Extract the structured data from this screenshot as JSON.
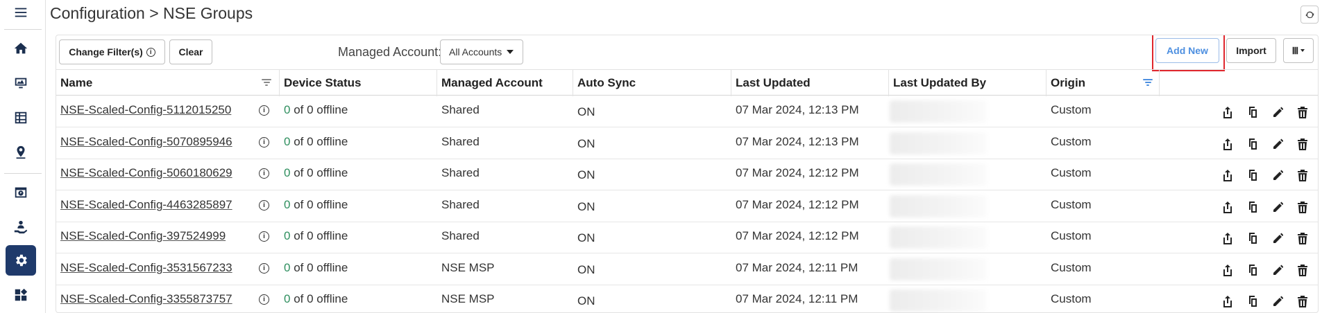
{
  "header": {
    "title": "Configuration > NSE Groups"
  },
  "sidebar": {
    "items": [
      {
        "icon": "menu-icon"
      },
      {
        "icon": "home-icon"
      },
      {
        "icon": "monitor-icon"
      },
      {
        "icon": "table-icon"
      },
      {
        "icon": "location-pin-icon"
      },
      {
        "icon": "dashboard-window-icon"
      },
      {
        "icon": "users-hand-icon"
      },
      {
        "icon": "gear-icon",
        "active": true
      },
      {
        "icon": "widgets-icon"
      }
    ]
  },
  "toolbar": {
    "change_filters_label": "Change Filter(s)",
    "info_glyph": "i",
    "clear_label": "Clear",
    "managed_account_label": "Managed Account:",
    "managed_account_value": "All Accounts",
    "add_new_label": "Add New",
    "import_label": "Import",
    "column_picker_glyph": "Ⅲ"
  },
  "table": {
    "columns": [
      "Name",
      "Device Status",
      "Managed Account",
      "Auto Sync",
      "Last Updated",
      "Last Updated By",
      "Origin"
    ],
    "rows": [
      {
        "name": "NSE-Scaled-Config-5112015250",
        "status_count": "0",
        "status_rest": "of 0 offline",
        "account": "Shared",
        "sync": "ON",
        "updated": "07 Mar 2024, 12:13 PM",
        "origin": "Custom"
      },
      {
        "name": "NSE-Scaled-Config-5070895946",
        "status_count": "0",
        "status_rest": "of 0 offline",
        "account": "Shared",
        "sync": "ON",
        "updated": "07 Mar 2024, 12:13 PM",
        "origin": "Custom"
      },
      {
        "name": "NSE-Scaled-Config-5060180629",
        "status_count": "0",
        "status_rest": "of 0 offline",
        "account": "Shared",
        "sync": "ON",
        "updated": "07 Mar 2024, 12:12 PM",
        "origin": "Custom"
      },
      {
        "name": "NSE-Scaled-Config-4463285897",
        "status_count": "0",
        "status_rest": "of 0 offline",
        "account": "Shared",
        "sync": "ON",
        "updated": "07 Mar 2024, 12:12 PM",
        "origin": "Custom"
      },
      {
        "name": "NSE-Scaled-Config-397524999",
        "status_count": "0",
        "status_rest": "of 0 offline",
        "account": "Shared",
        "sync": "ON",
        "updated": "07 Mar 2024, 12:12 PM",
        "origin": "Custom"
      },
      {
        "name": "NSE-Scaled-Config-3531567233",
        "status_count": "0",
        "status_rest": "of 0 offline",
        "account": "NSE MSP",
        "sync": "ON",
        "updated": "07 Mar 2024, 12:11 PM",
        "origin": "Custom"
      },
      {
        "name": "NSE-Scaled-Config-3355873757",
        "status_count": "0",
        "status_rest": "of 0 offline",
        "account": "NSE MSP",
        "sync": "ON",
        "updated": "07 Mar 2024, 12:11 PM",
        "origin": "Custom"
      }
    ],
    "row_info_glyph": "i",
    "row_actions": [
      "export-icon",
      "copy-icon",
      "edit-pencil-icon",
      "delete-trash-icon"
    ]
  },
  "colors": {
    "sidebar_active": "#1f3a6b",
    "add_new_text": "#4d8fe0",
    "highlight_box": "#e0262d",
    "status_green": "#2f8f5f",
    "origin_filter_active": "#4d8fe0"
  }
}
